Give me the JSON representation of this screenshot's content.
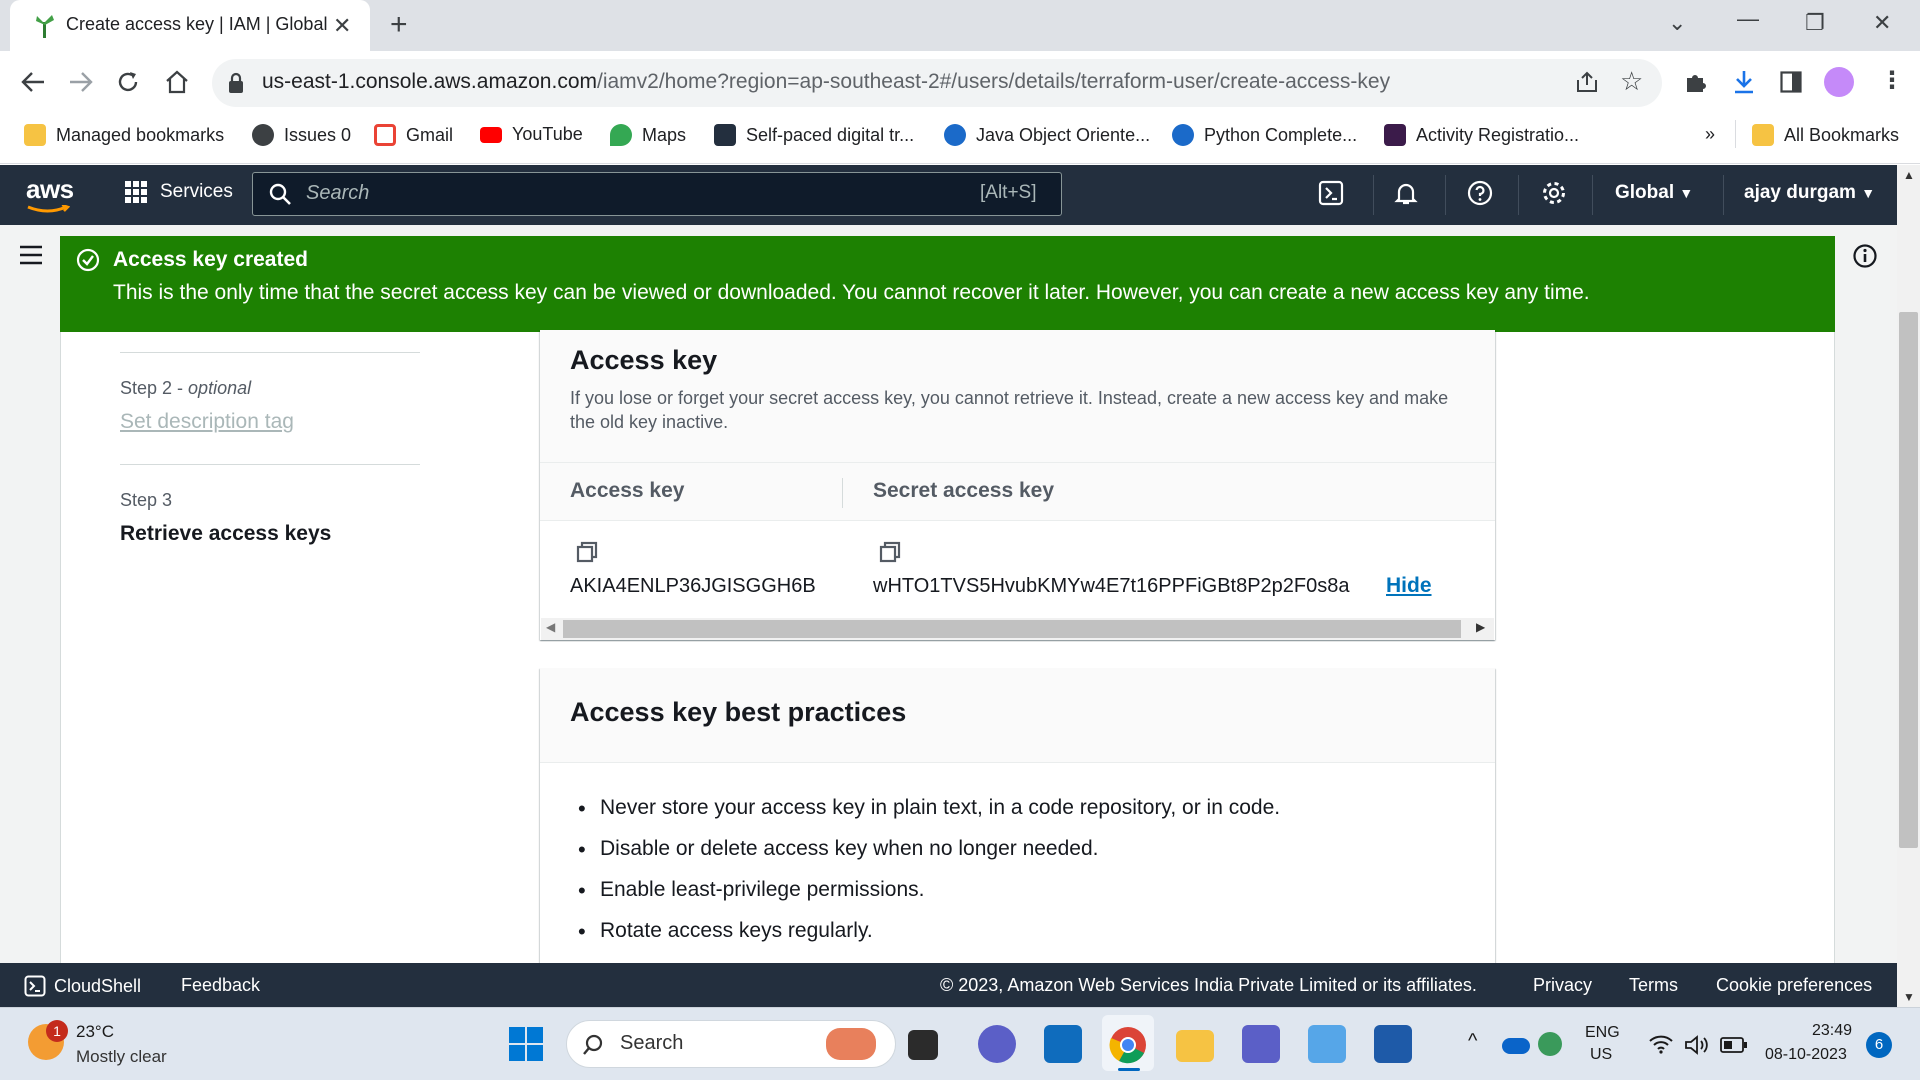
{
  "browser": {
    "tab_title": "Create access key | IAM | Global",
    "url_host": "us-east-1.console.aws.amazon.com",
    "url_path": "/iamv2/home?region=ap-southeast-2#/users/details/terraform-user/create-access-key",
    "bookmarks": [
      {
        "label": "Managed bookmarks",
        "icon": "folder-icon"
      },
      {
        "label": "Issues 0",
        "icon": "github-icon"
      },
      {
        "label": "Gmail",
        "icon": "gmail-icon"
      },
      {
        "label": "YouTube",
        "icon": "youtube-icon"
      },
      {
        "label": "Maps",
        "icon": "maps-icon"
      },
      {
        "label": "Self-paced digital tr...",
        "icon": "aws-icon"
      },
      {
        "label": "Java Object Oriente...",
        "icon": "cloud-icon"
      },
      {
        "label": "Python Complete...",
        "icon": "cloud-icon"
      },
      {
        "label": "Activity Registratio...",
        "icon": "activity-icon"
      }
    ],
    "overflow": "»",
    "all_bookmarks": "All Bookmarks"
  },
  "aws_nav": {
    "logo": "aws",
    "services": "Services",
    "search_placeholder": "Search",
    "search_shortcut": "[Alt+S]",
    "region": "Global",
    "user": "ajay durgam"
  },
  "flash": {
    "title": "Access key created",
    "message": "This is the only time that the secret access key can be viewed or downloaded. You cannot recover it later. However, you can create a new access key any time."
  },
  "steps": {
    "step2_label": "Step 2",
    "step2_optional": "optional",
    "step2_title": "Set description tag",
    "step3_label": "Step 3",
    "step3_title": "Retrieve access keys"
  },
  "access_key_card": {
    "title": "Access key",
    "description": "If you lose or forget your secret access key, you cannot retrieve it. Instead, create a new access key and make the old key inactive.",
    "col1_header": "Access key",
    "col2_header": "Secret access key",
    "access_key": "AKIA4ENLP36JGISGGH6B",
    "secret_key": "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",
    "hide_label": "Hide"
  },
  "best_practices": {
    "title": "Access key best practices",
    "items": [
      "Never store your access key in plain text, in a code repository, or in code.",
      "Disable or delete access key when no longer needed.",
      "Enable least-privilege permissions.",
      "Rotate access keys regularly."
    ]
  },
  "footer": {
    "cloudshell": "CloudShell",
    "feedback": "Feedback",
    "copyright": "© 2023, Amazon Web Services India Private Limited or its affiliates.",
    "privacy": "Privacy",
    "terms": "Terms",
    "cookie": "Cookie preferences"
  },
  "taskbar": {
    "weather_badge": "1",
    "temperature": "23°C",
    "weather": "Mostly clear",
    "search": "Search",
    "lang_top": "ENG",
    "lang_bottom": "US",
    "time": "23:49",
    "date": "08-10-2023",
    "notifications": "6"
  },
  "colors": {
    "aws_nav": "#232f3e",
    "success": "#1d8102",
    "link": "#0073bb"
  }
}
